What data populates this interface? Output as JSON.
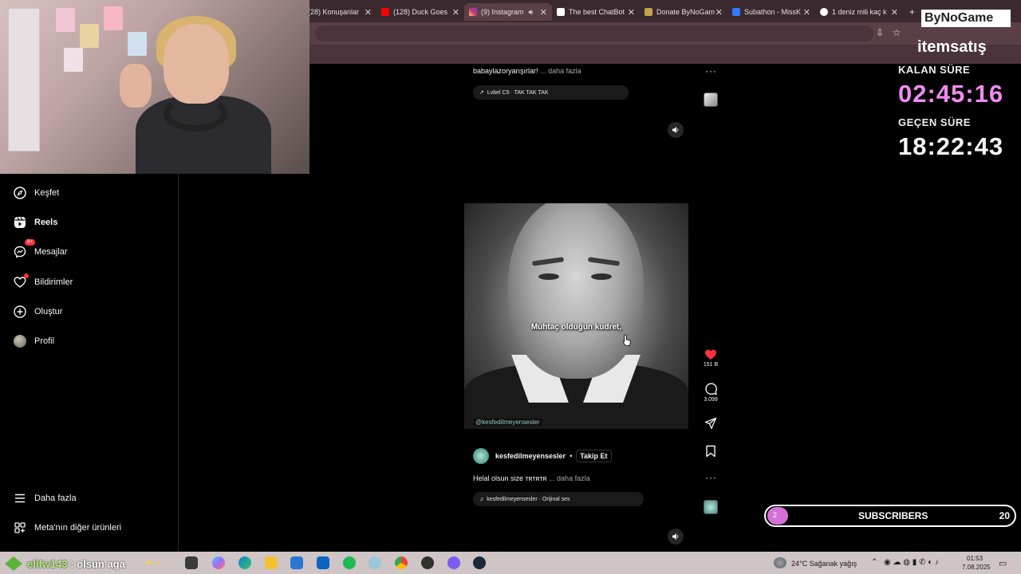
{
  "browser": {
    "tabs": [
      {
        "label": "(28) Konuşanlar",
        "color": "#8a6d74"
      },
      {
        "label": "(128) Duck Goes",
        "color": "#ff0000"
      },
      {
        "label": "(9) Instagram",
        "color": "#d6249f"
      },
      {
        "label": "The best ChatBot",
        "color": "#ffffff"
      },
      {
        "label": "Donate ByNoGam",
        "color": "#c7a24c"
      },
      {
        "label": "Subathon - MissK",
        "color": "#2f7cff"
      },
      {
        "label": "1 deniz mili kaç k",
        "color": "#ffffff"
      }
    ],
    "new_tab": "+"
  },
  "sidebar": {
    "items": [
      {
        "label": "Keşfet",
        "icon": "compass-icon"
      },
      {
        "label": "Reels",
        "icon": "reels-icon"
      },
      {
        "label": "Mesajlar",
        "icon": "messenger-icon",
        "badge": "9+"
      },
      {
        "label": "Bildirimler",
        "icon": "heart-icon"
      },
      {
        "label": "Oluştur",
        "icon": "plus-square-icon"
      },
      {
        "label": "Profil",
        "icon": "avatar"
      }
    ],
    "bottom": [
      {
        "label": "Daha fazla",
        "icon": "menu-icon"
      },
      {
        "label": "Meta'nın diğer ürünleri",
        "icon": "grid-icon"
      }
    ]
  },
  "feed": {
    "prev_post": {
      "desc": "babaylazoryarışırlar!",
      "more": "... daha fazla",
      "audio": "Lvbel C5 · TAK TAK TAK"
    },
    "post": {
      "caption_overlay": "Muhtaç olduğun kudret,",
      "watermark": "@kesfedilmeyensesler",
      "likes": "151 B",
      "comments": "3.099",
      "username": "kesfedilmeyensesler",
      "separator": "•",
      "follow": "Takip Et",
      "desc": "Helal olsun size ᴛʀᴛʀᴛʀ",
      "more": "... daha fazla",
      "audio": "kesfedilmeyensesler · Orijinal ses"
    }
  },
  "stream_overlay": {
    "logo1": "ByNoGame",
    "logo2": "itemsatış",
    "remaining_label": "KALAN SÜRE",
    "remaining_time": "02:45:16",
    "elapsed_label": "GEÇEN SÜRE",
    "elapsed_time": "18:22:43",
    "remaining_color": "#f08cf0",
    "sub_current": "2",
    "sub_label": "SUBSCRIBERS",
    "sub_goal": "20",
    "chat_user": "elifw143",
    "chat_msg": "olsun aga"
  },
  "taskbar": {
    "weather": "24°C  Sağanak yağış",
    "time": "01:53",
    "date": "7.08.2025"
  }
}
